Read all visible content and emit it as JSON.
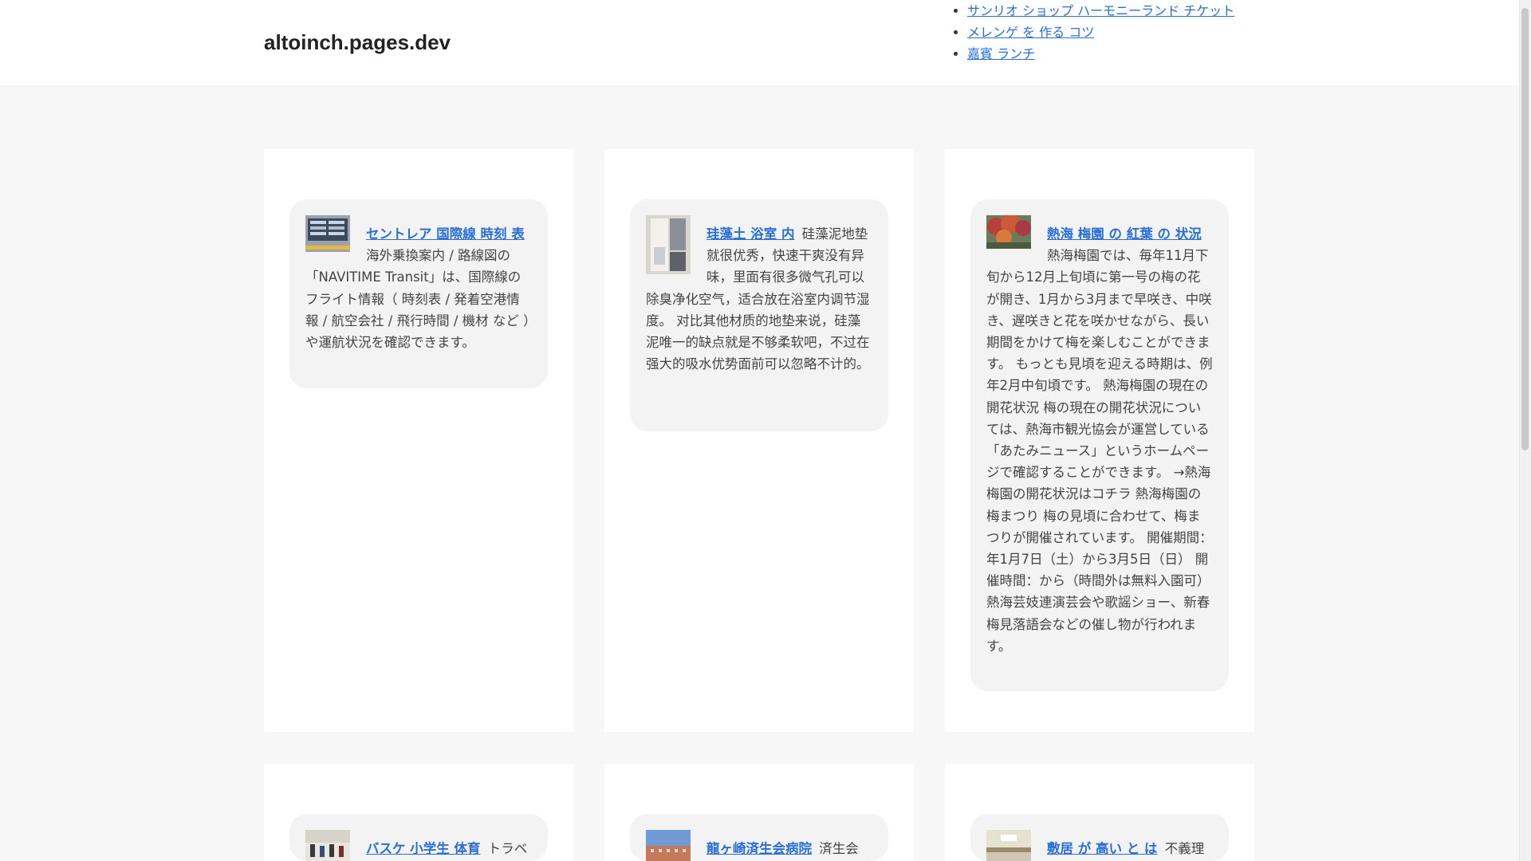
{
  "header": {
    "site_title": "altoinch.pages.dev",
    "nav": [
      "サンリオ ショップ ハーモニーランド チケット",
      "メレンゲ を 作る コツ",
      "嘉賓 ランチ"
    ]
  },
  "cards": [
    {
      "title": "セントレア 国際線 時刻 表",
      "body": "海外乗換案内 / 路線図の「NAVITIME Transit」は、国際線のフライト情報（ 時刻表 / 発着空港情報 / 航空会社 / 飛行時間 / 機材 など ）や運航状況を確認できます。",
      "thumb_icon": "airport-departure-board-photo"
    },
    {
      "title": "珪藻土 浴室 内",
      "body": "硅藻泥地垫就很优秀，快速干爽没有异味，里面有很多微气孔可以除臭净化空气，适合放在浴室内调节湿度。 对比其他材质的地垫来说，硅藻泥唯一的缺点就是不够柔软吧，不过在强大的吸水优势面前可以忽略不计的。",
      "thumb_icon": "bathroom-photo"
    },
    {
      "title": "熱海 梅園 の 紅葉 の 状況",
      "body": "熱海梅園では、毎年11月下旬から12月上旬頃に第一号の梅の花が開き、1月から3月まで早咲き、中咲き、遅咲きと花を咲かせながら、長い期間をかけて梅を楽しむことができます。 もっとも見頃を迎える時期は、例年2月中旬頃です。 熱海梅園の現在の開花状況 梅の現在の開花状況については、熱海市観光協会が運営している「あたみニュース」というホームページで確認することができます。 →熱海梅園の開花状況はコチラ 熱海梅園の梅まつり 梅の見頃に合わせて、梅まつりが開催されています。 開催期間：年1月7日（土）から3月5日（日） 開催時間：から（時間外は無料入園可） 熱海芸妓連演芸会や歌謡ショー、新春梅見落語会などの催し物が行われます。",
      "thumb_icon": "autumn-leaves-photo"
    },
    {
      "title": "バスケ 小学生 体育",
      "body": "トラベ",
      "thumb_icon": "gym-photo"
    },
    {
      "title": "龍ヶ崎済生会病院",
      "body": "済生会",
      "thumb_icon": "hospital-building-photo"
    },
    {
      "title": "敷居 が 高い と は",
      "body": "不義理",
      "thumb_icon": "threshold-photo"
    }
  ]
}
